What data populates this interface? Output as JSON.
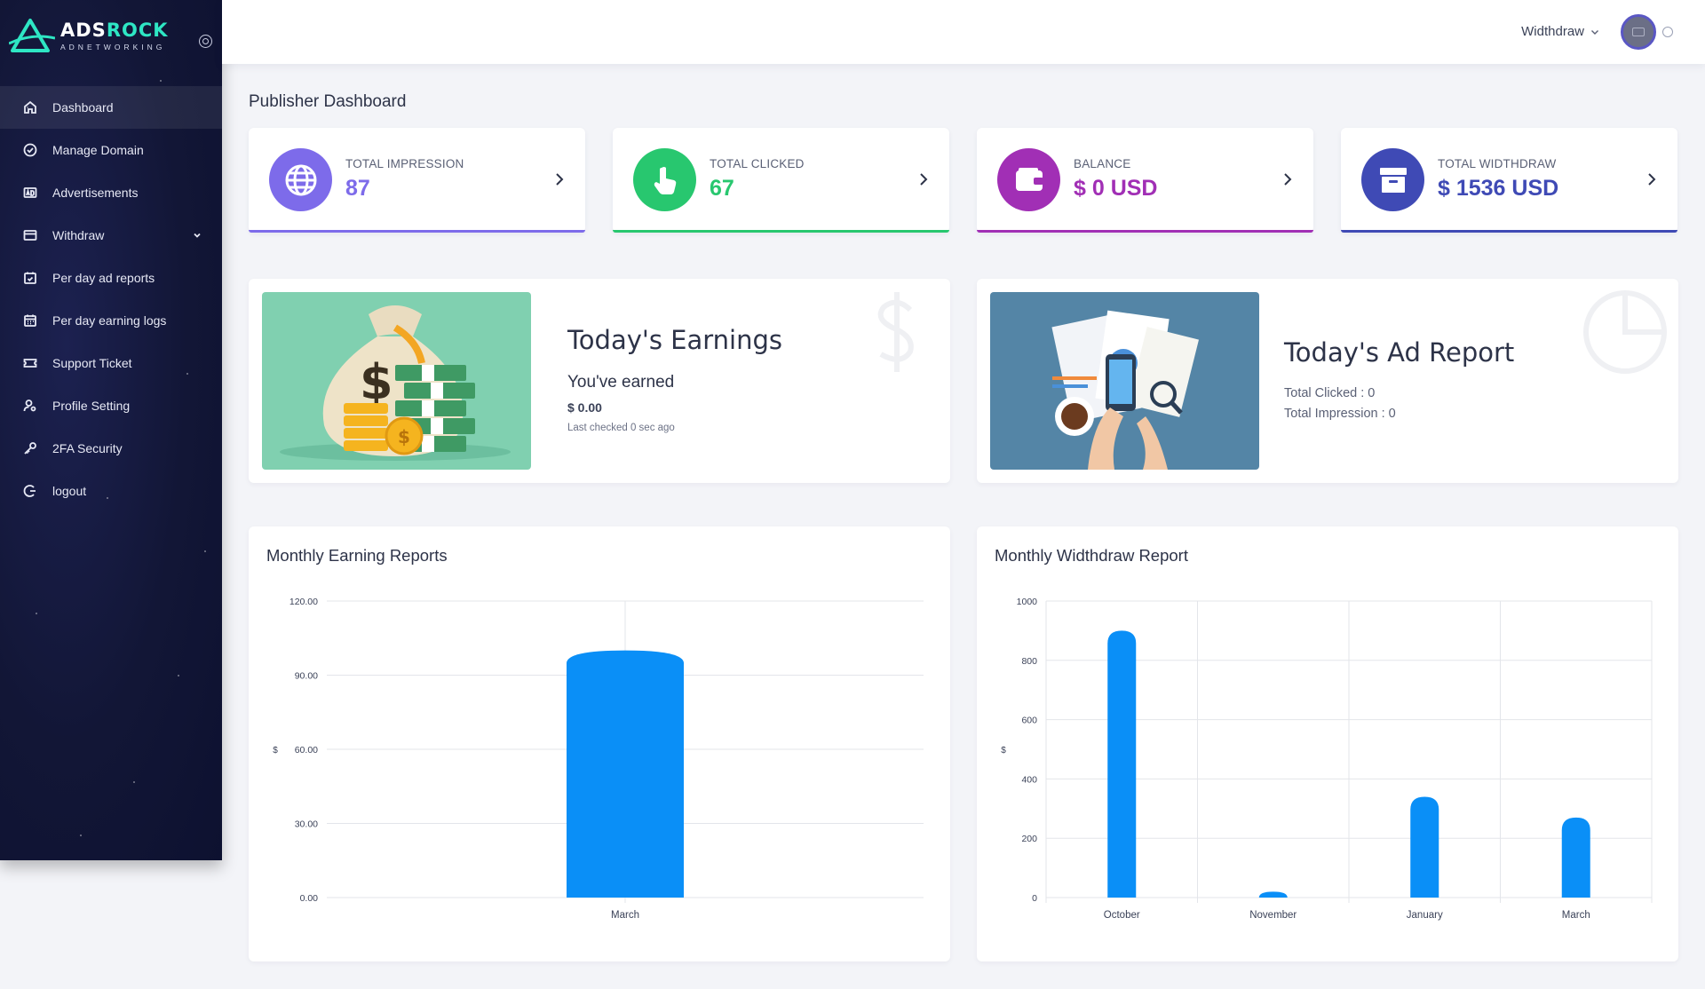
{
  "app": {
    "logo_title_a": "ADS",
    "logo_title_b": "ROCK",
    "logo_subtitle": "ADNETWORKING",
    "accent_color": "#2ee6c4"
  },
  "sidebar": {
    "items": [
      {
        "label": "Dashboard",
        "icon": "home-icon",
        "active": true
      },
      {
        "label": "Manage Domain",
        "icon": "check-circle-icon"
      },
      {
        "label": "Advertisements",
        "icon": "ad-icon"
      },
      {
        "label": "Withdraw",
        "icon": "wallet-icon",
        "has_submenu": true
      },
      {
        "label": "Per day ad reports",
        "icon": "calendar-check-icon"
      },
      {
        "label": "Per day earning logs",
        "icon": "calendar-icon"
      },
      {
        "label": "Support Ticket",
        "icon": "ticket-icon"
      },
      {
        "label": "Profile Setting",
        "icon": "user-settings-icon"
      },
      {
        "label": "2FA Security",
        "icon": "key-icon"
      },
      {
        "label": "logout",
        "icon": "logout-icon"
      }
    ]
  },
  "topbar": {
    "withdraw_label": "Widthdraw",
    "avatar_icon": "avatar-icon"
  },
  "page": {
    "title": "Publisher Dashboard"
  },
  "stats": [
    {
      "label": "TOTAL IMPRESSION",
      "value": "87",
      "color": "#7d6bea",
      "icon": "globe-icon"
    },
    {
      "label": "TOTAL CLICKED",
      "value": "67",
      "color": "#28c76f",
      "icon": "hand-pointer-icon"
    },
    {
      "label": "BALANCE",
      "value": "$ 0 USD",
      "color": "#a12fb5",
      "icon": "wallet-icon"
    },
    {
      "label": "TOTAL WIDTHDRAW",
      "value": "$ 1536 USD",
      "color": "#3f4ab5",
      "icon": "archive-icon"
    }
  ],
  "earnings": {
    "title": "Today's Earnings",
    "subtitle": "You've earned",
    "amount": "$ 0.00",
    "last_checked": "Last checked 0 sec ago"
  },
  "ad_report": {
    "title": "Today's Ad Report",
    "clicked": "Total Clicked : 0",
    "impression": "Total Impression : 0"
  },
  "chart_data": [
    {
      "type": "bar",
      "title": "Monthly Earning Reports",
      "ylabel": "$",
      "categories": [
        "March"
      ],
      "values": [
        100
      ],
      "ylim": [
        0,
        120
      ],
      "yticks": [
        "0.00",
        "30.00",
        "60.00",
        "90.00",
        "120.00"
      ],
      "ytick_values": [
        0,
        30,
        60,
        90,
        120
      ],
      "color": "#0a8ff7",
      "grid": true
    },
    {
      "type": "bar",
      "title": "Monthly Widthdraw Report",
      "ylabel": "$",
      "categories": [
        "October",
        "November",
        "January",
        "March"
      ],
      "values": [
        900,
        20,
        340,
        270
      ],
      "ylim": [
        0,
        1000
      ],
      "yticks": [
        "0",
        "200",
        "400",
        "600",
        "800",
        "1000"
      ],
      "ytick_values": [
        0,
        200,
        400,
        600,
        800,
        1000
      ],
      "color": "#0a8ff7",
      "grid": true
    }
  ]
}
